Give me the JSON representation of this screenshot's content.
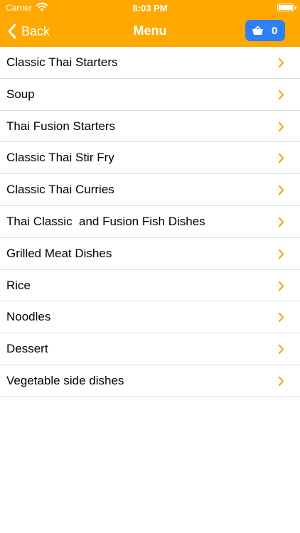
{
  "status_bar": {
    "carrier": "Carrier",
    "time": "8:03 PM",
    "wifi_icon": "wifi-icon",
    "battery_icon": "battery-icon"
  },
  "nav_bar": {
    "back_label": "Back",
    "back_icon": "chevron-left-icon",
    "title": "Menu",
    "basket_icon": "basket-icon",
    "basket_count": "0"
  },
  "menu": {
    "items": [
      {
        "label": "Classic Thai Starters"
      },
      {
        "label": "Soup"
      },
      {
        "label": "Thai Fusion Starters"
      },
      {
        "label": "Classic Thai Stir Fry"
      },
      {
        "label": "Classic Thai Curries"
      },
      {
        "label": "Thai Classic  and Fusion Fish Dishes"
      },
      {
        "label": "Grilled Meat Dishes"
      },
      {
        "label": "Rice"
      },
      {
        "label": "Noodles"
      },
      {
        "label": "Dessert"
      },
      {
        "label": "Vegetable side dishes"
      }
    ],
    "row_icon": "chevron-right-icon"
  },
  "colors": {
    "nav_background": "#ffa800",
    "basket_button": "#2f7ff5",
    "chevron_accent": "#f2a81d",
    "separator": "#dcdcdc"
  }
}
